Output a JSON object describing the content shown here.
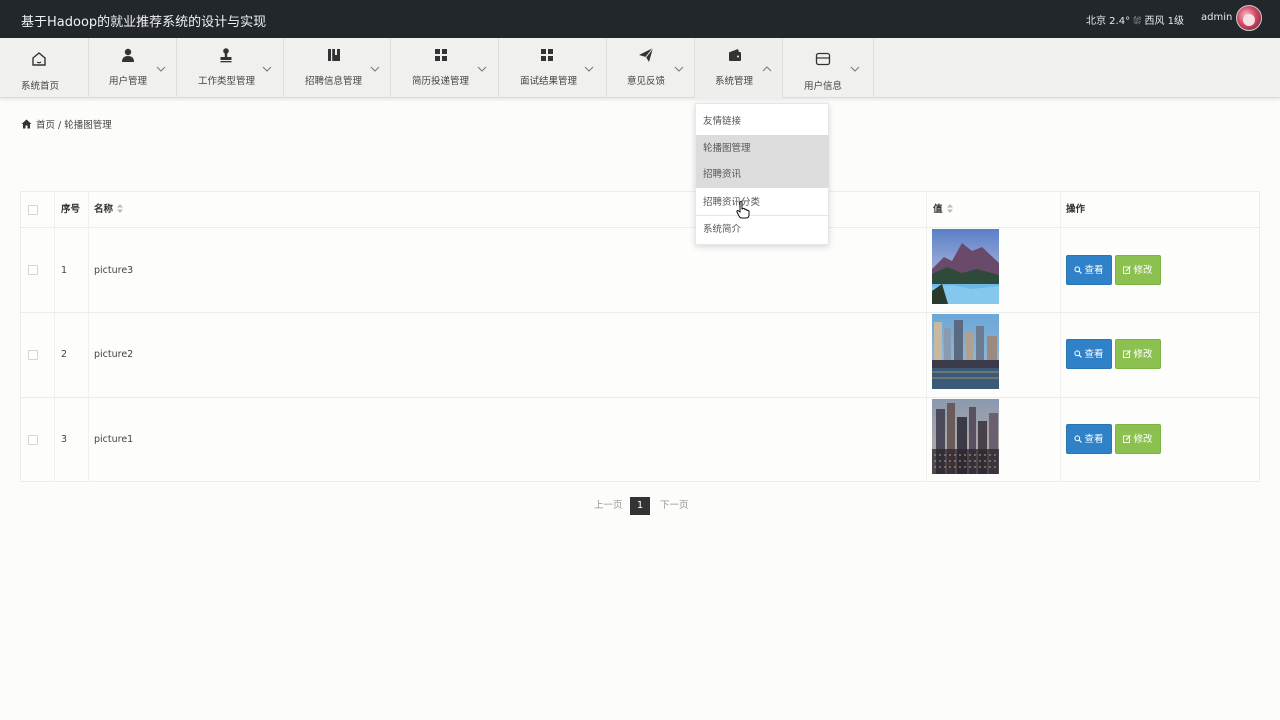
{
  "header": {
    "title": "基于Hadoop的就业推荐系统的设计与实现",
    "weather": "北京  2.4°  ⛆  西风  1级",
    "username": "admin"
  },
  "nav": {
    "items": [
      {
        "label": "系统首页",
        "icon": "home-icon"
      },
      {
        "label": "用户管理",
        "icon": "user-icon"
      },
      {
        "label": "工作类型管理",
        "icon": "stamp-icon"
      },
      {
        "label": "招聘信息管理",
        "icon": "book-icon"
      },
      {
        "label": "简历投递管理",
        "icon": "grid-icon"
      },
      {
        "label": "面试结果管理",
        "icon": "grid-icon"
      },
      {
        "label": "意见反馈",
        "icon": "send-icon"
      },
      {
        "label": "系统管理",
        "icon": "wallet-icon"
      },
      {
        "label": "用户信息",
        "icon": "card-icon"
      }
    ],
    "dropdown": [
      "友情链接",
      "轮播图管理",
      "招聘资讯",
      "招聘资讯分类",
      "系统简介"
    ]
  },
  "breadcrumb": {
    "home": "首页",
    "separator": "/",
    "current": "轮播图管理"
  },
  "table": {
    "headers": {
      "index": "序号",
      "name": "名称",
      "value": "值",
      "action": "操作"
    },
    "rows": [
      {
        "index": "1",
        "name": "picture3",
        "image": "mountain-lake-image"
      },
      {
        "index": "2",
        "name": "picture2",
        "image": "city-waterfront-image"
      },
      {
        "index": "3",
        "name": "picture1",
        "image": "city-skyline-image"
      }
    ],
    "view_label": "查看",
    "edit_label": "修改"
  },
  "pagination": {
    "prev": "上一页",
    "current": "1",
    "next": "下一页"
  },
  "colors": {
    "topbar": "#22272c",
    "view_button": "#2f82c7",
    "edit_button": "#8cc152"
  }
}
